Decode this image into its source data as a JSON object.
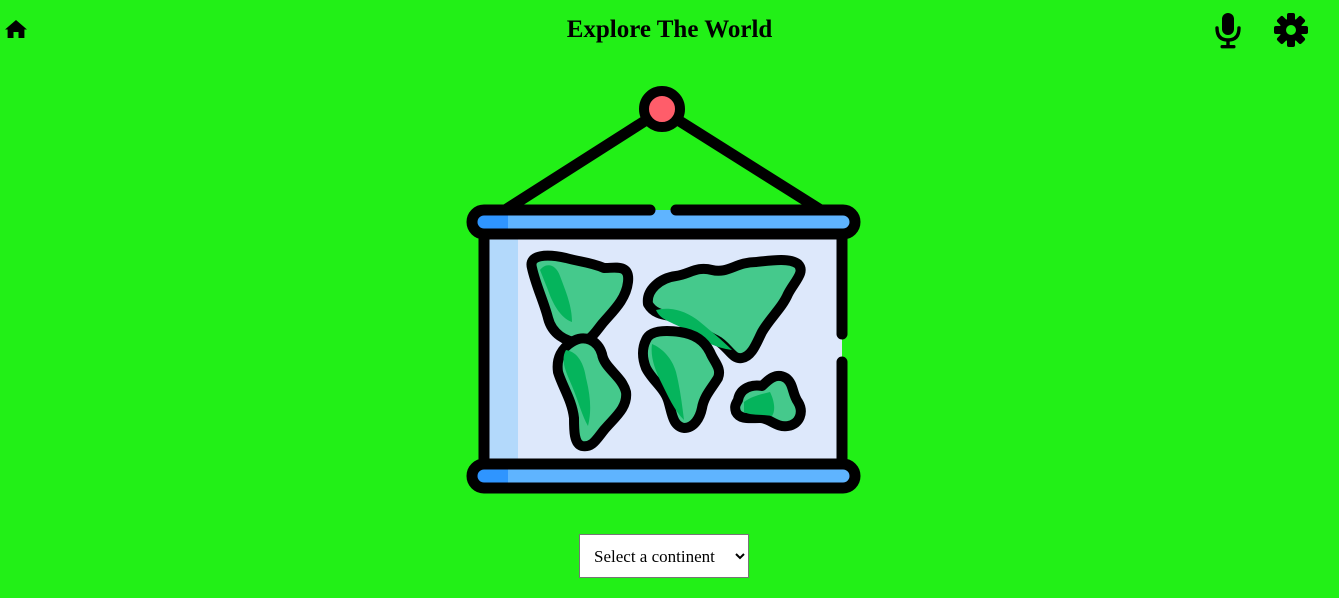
{
  "header": {
    "title": "Explore The World",
    "home_icon": "home-icon",
    "mic_icon": "microphone-icon",
    "settings_icon": "gear-icon"
  },
  "illustration": {
    "icon": "hanging-world-map-icon",
    "colors": {
      "pin": "#ff5d6a",
      "roller": "#5fb4ff",
      "roller_dark": "#2f95ff",
      "board": "#dde8fb",
      "board_edge": "#b3d9fb",
      "land": "#45c98c",
      "land_dark": "#05b45c"
    }
  },
  "continent_select": {
    "selected": "Select a continent",
    "options": [
      "Select a continent"
    ]
  },
  "colors": {
    "background": "#22f017",
    "foreground": "#000000"
  }
}
